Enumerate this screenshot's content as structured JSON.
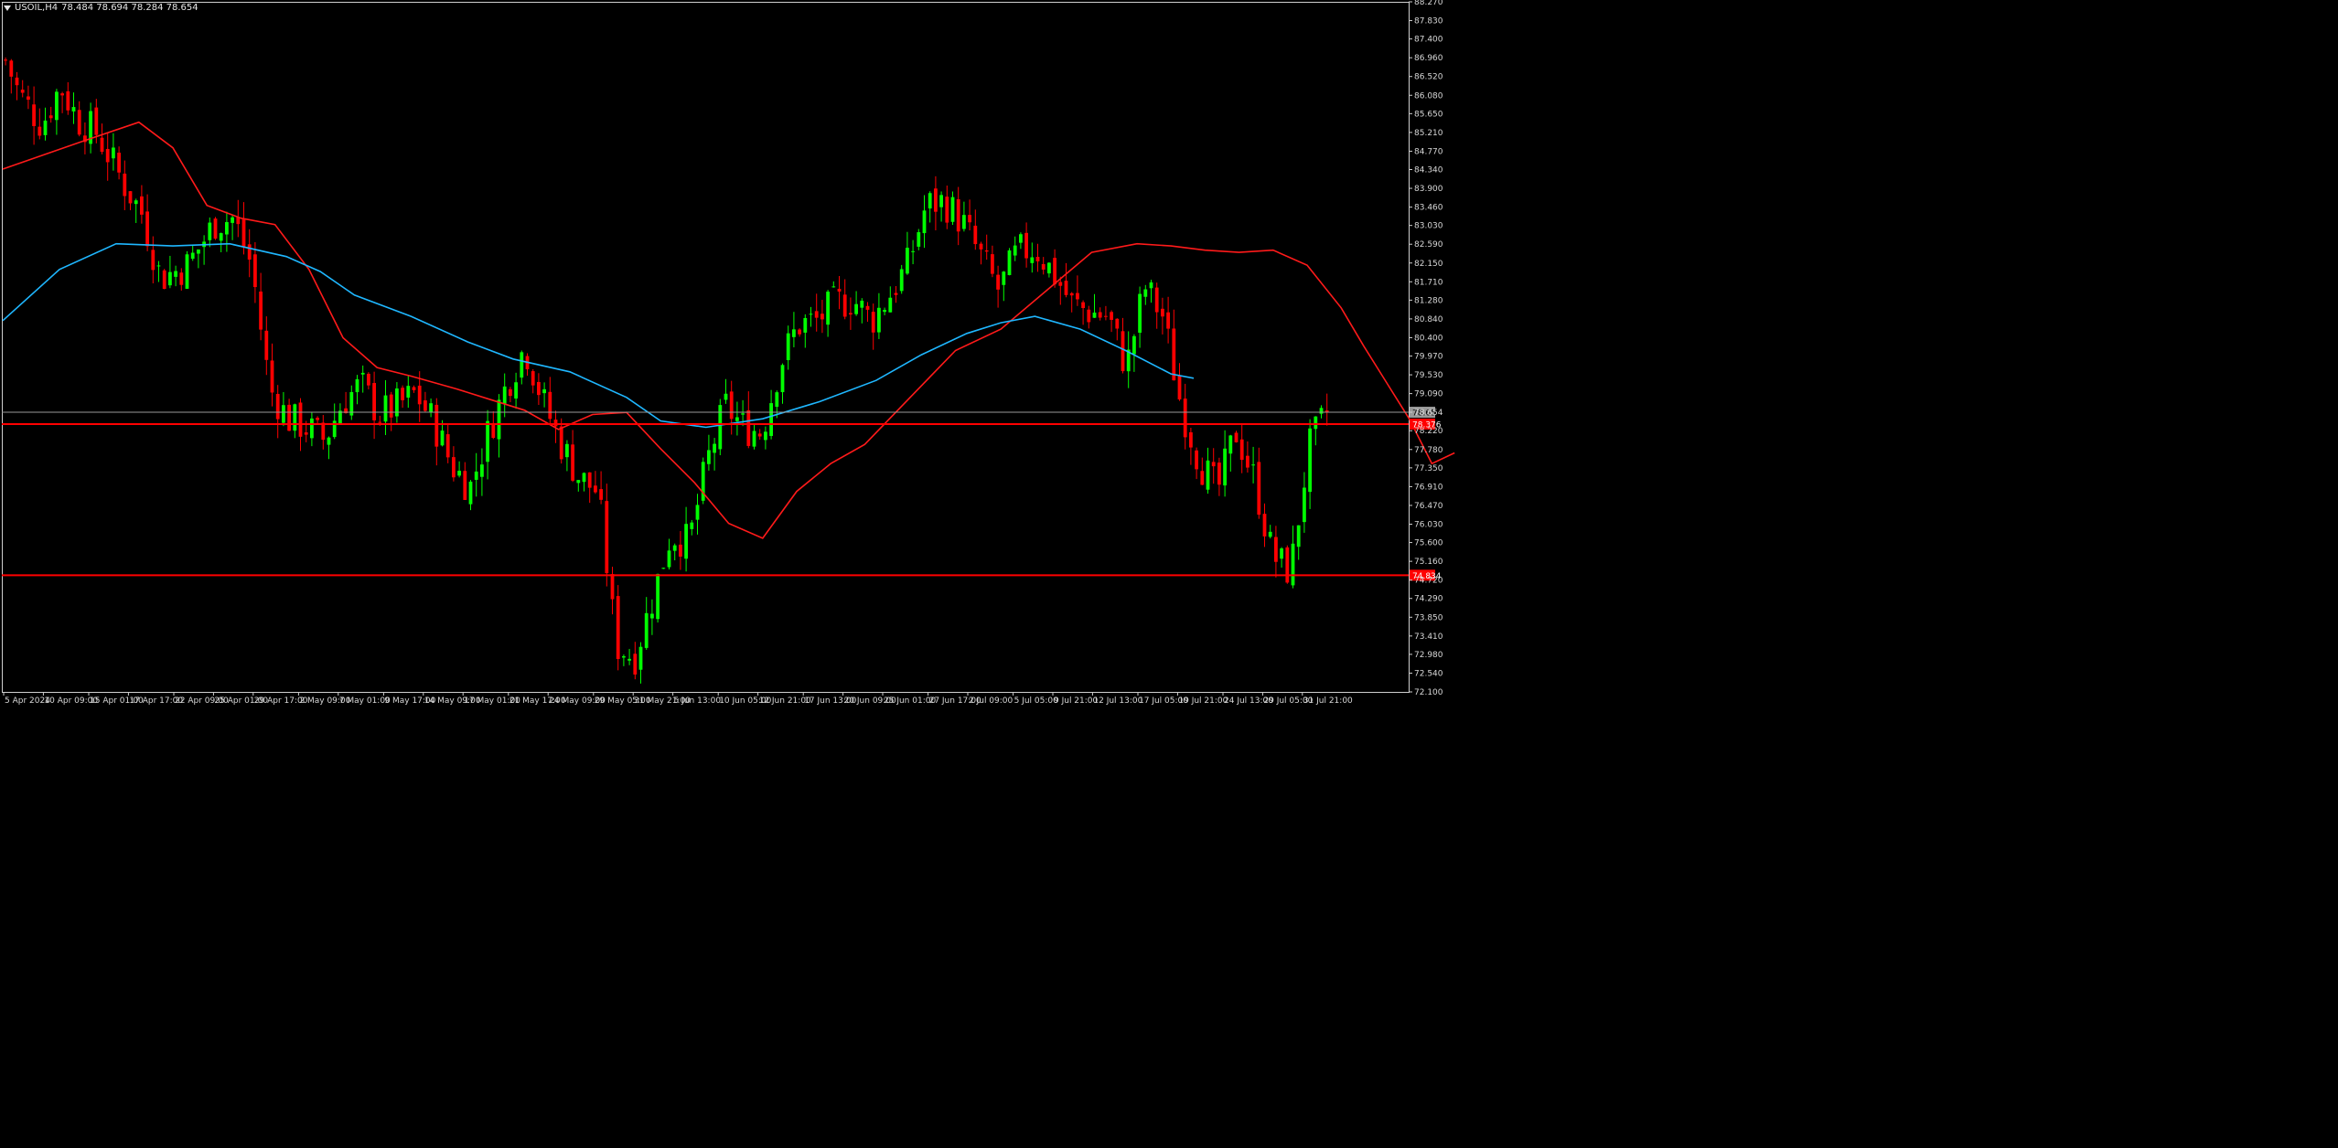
{
  "header": {
    "symbol": "USOIL,H4",
    "ohlc": "78.484 78.694 78.284 78.654"
  },
  "colors": {
    "background": "#000000",
    "bull": "#00ff00",
    "bear": "#ff0000",
    "ma_fast": "#ff1a1a",
    "ma_slow": "#1fb7ff",
    "support_line": "#ff0000",
    "bid_line": "#9a9a9a",
    "axis_text": "#d8d8d8",
    "frame": "#cfcfcf"
  },
  "chart_data": {
    "type": "candlestick",
    "symbol": "USOIL",
    "timeframe": "H4",
    "last_price": 78.654,
    "ylim": [
      72.1,
      88.27
    ],
    "y_ticks": [
      "88.270",
      "87.830",
      "87.400",
      "86.960",
      "86.520",
      "86.080",
      "85.650",
      "85.210",
      "84.770",
      "84.340",
      "83.900",
      "83.460",
      "83.030",
      "82.590",
      "82.150",
      "81.710",
      "81.280",
      "80.840",
      "80.400",
      "79.970",
      "79.530",
      "79.090",
      "78.654",
      "78.220",
      "77.780",
      "77.350",
      "76.910",
      "76.470",
      "76.030",
      "75.600",
      "75.160",
      "74.720",
      "74.290",
      "73.850",
      "73.410",
      "72.980",
      "72.540",
      "72.100"
    ],
    "x_ticks": [
      "5 Apr 2024",
      "10 Apr 09:00",
      "15 Apr 01:00",
      "17 Apr 17:00",
      "22 Apr 09:00",
      "25 Apr 01:00",
      "29 Apr 17:00",
      "2 May 09:00",
      "7 May 01:00",
      "9 May 17:00",
      "14 May 09:00",
      "17 May 01:00",
      "21 May 17:00",
      "24 May 09:00",
      "29 May 05:00",
      "31 May 21:00",
      "5 Jun 13:00",
      "10 Jun 05:00",
      "12 Jun 21:00",
      "17 Jun 13:00",
      "20 Jun 09:00",
      "25 Jun 01:00",
      "27 Jun 17:00",
      "2 Jul 09:00",
      "5 Jul 05:00",
      "9 Jul 21:00",
      "12 Jul 13:00",
      "17 Jul 05:00",
      "19 Jul 21:00",
      "24 Jul 13:00",
      "29 Jul 05:00",
      "31 Jul 21:00"
    ],
    "bars_count": 234,
    "close_path": [
      [
        0,
        86.9
      ],
      [
        3,
        86.1
      ],
      [
        8,
        85.4
      ],
      [
        12,
        86.3
      ],
      [
        16,
        85.5
      ],
      [
        20,
        85.2
      ],
      [
        26,
        84.0
      ],
      [
        30,
        83.3
      ],
      [
        34,
        81.8
      ],
      [
        40,
        82.1
      ],
      [
        46,
        83.1
      ],
      [
        50,
        83.2
      ],
      [
        54,
        82.1
      ],
      [
        58,
        79.2
      ],
      [
        62,
        78.5
      ],
      [
        66,
        78.3
      ],
      [
        70,
        78.0
      ],
      [
        74,
        78.9
      ],
      [
        78,
        79.3
      ],
      [
        82,
        78.6
      ],
      [
        86,
        78.8
      ],
      [
        90,
        79.1
      ],
      [
        94,
        78.4
      ],
      [
        98,
        77.4
      ],
      [
        102,
        76.9
      ],
      [
        106,
        78.2
      ],
      [
        110,
        79.3
      ],
      [
        114,
        80.2
      ],
      [
        118,
        78.9
      ],
      [
        122,
        77.9
      ],
      [
        126,
        77.1
      ],
      [
        130,
        76.8
      ],
      [
        134,
        73.2
      ],
      [
        138,
        72.9
      ],
      [
        142,
        74.3
      ],
      [
        146,
        75.8
      ],
      [
        150,
        75.6
      ],
      [
        154,
        77.5
      ],
      [
        158,
        78.8
      ],
      [
        162,
        78.3
      ],
      [
        166,
        78.2
      ],
      [
        170,
        79.8
      ],
      [
        174,
        80.7
      ],
      [
        178,
        80.8
      ],
      [
        182,
        81.2
      ],
      [
        186,
        81.3
      ],
      [
        190,
        80.8
      ],
      [
        194,
        81.4
      ],
      [
        198,
        82.1
      ],
      [
        202,
        83.5
      ],
      [
        206,
        83.6
      ],
      [
        210,
        83.1
      ],
      [
        214,
        82.3
      ],
      [
        218,
        81.5
      ],
      [
        222,
        82.4
      ],
      [
        226,
        82.5
      ],
      [
        230,
        81.9
      ],
      [
        234,
        81.2
      ],
      [
        238,
        81.0
      ],
      [
        242,
        80.9
      ],
      [
        246,
        79.7
      ],
      [
        250,
        81.6
      ],
      [
        254,
        80.9
      ],
      [
        258,
        78.8
      ],
      [
        262,
        77.5
      ],
      [
        266,
        76.8
      ],
      [
        270,
        78.2
      ],
      [
        274,
        77.1
      ],
      [
        278,
        75.3
      ],
      [
        282,
        74.9
      ],
      [
        286,
        77.8
      ],
      [
        290,
        78.65
      ]
    ],
    "moving_averages": [
      {
        "color": "#ff1a1a",
        "points": [
          [
            0,
            84.35
          ],
          [
            14,
            85.0
          ],
          [
            24,
            85.45
          ],
          [
            30,
            84.85
          ],
          [
            36,
            83.5
          ],
          [
            42,
            83.2
          ],
          [
            48,
            83.05
          ],
          [
            54,
            82.0
          ],
          [
            60,
            80.4
          ],
          [
            66,
            79.7
          ],
          [
            72,
            79.5
          ],
          [
            80,
            79.2
          ],
          [
            86,
            78.95
          ],
          [
            92,
            78.7
          ],
          [
            98,
            78.25
          ],
          [
            104,
            78.6
          ],
          [
            110,
            78.65
          ],
          [
            116,
            77.8
          ],
          [
            122,
            77.0
          ],
          [
            128,
            76.05
          ],
          [
            134,
            75.7
          ],
          [
            140,
            76.8
          ],
          [
            146,
            77.45
          ],
          [
            152,
            77.9
          ],
          [
            160,
            79.0
          ],
          [
            168,
            80.1
          ],
          [
            176,
            80.6
          ],
          [
            184,
            81.5
          ],
          [
            192,
            82.4
          ],
          [
            200,
            82.6
          ],
          [
            206,
            82.55
          ],
          [
            212,
            82.45
          ],
          [
            218,
            82.4
          ],
          [
            224,
            82.45
          ],
          [
            230,
            82.1
          ],
          [
            236,
            81.1
          ],
          [
            240,
            80.2
          ],
          [
            244,
            79.35
          ],
          [
            248,
            78.5
          ],
          [
            252,
            77.45
          ],
          [
            256,
            77.7
          ]
        ]
      },
      {
        "color": "#1fb7ff",
        "points": [
          [
            0,
            80.8
          ],
          [
            10,
            82.0
          ],
          [
            20,
            82.6
          ],
          [
            30,
            82.55
          ],
          [
            40,
            82.6
          ],
          [
            50,
            82.3
          ],
          [
            56,
            81.95
          ],
          [
            62,
            81.4
          ],
          [
            72,
            80.9
          ],
          [
            82,
            80.3
          ],
          [
            90,
            79.9
          ],
          [
            100,
            79.6
          ],
          [
            110,
            79.0
          ],
          [
            116,
            78.45
          ],
          [
            124,
            78.3
          ],
          [
            134,
            78.5
          ],
          [
            144,
            78.9
          ],
          [
            154,
            79.4
          ],
          [
            162,
            80.0
          ],
          [
            170,
            80.5
          ],
          [
            176,
            80.75
          ],
          [
            182,
            80.9
          ],
          [
            190,
            80.6
          ],
          [
            198,
            80.1
          ],
          [
            206,
            79.55
          ],
          [
            210,
            79.45
          ]
        ]
      }
    ],
    "horizontal_levels": [
      {
        "price": 78.376,
        "color": "#ff0000",
        "label": "78.376"
      },
      {
        "price": 74.834,
        "color": "#ff0000",
        "label": "74.834"
      },
      {
        "price": 78.654,
        "color": "#9a9a9a",
        "label": "78.654"
      }
    ],
    "grid": false
  }
}
